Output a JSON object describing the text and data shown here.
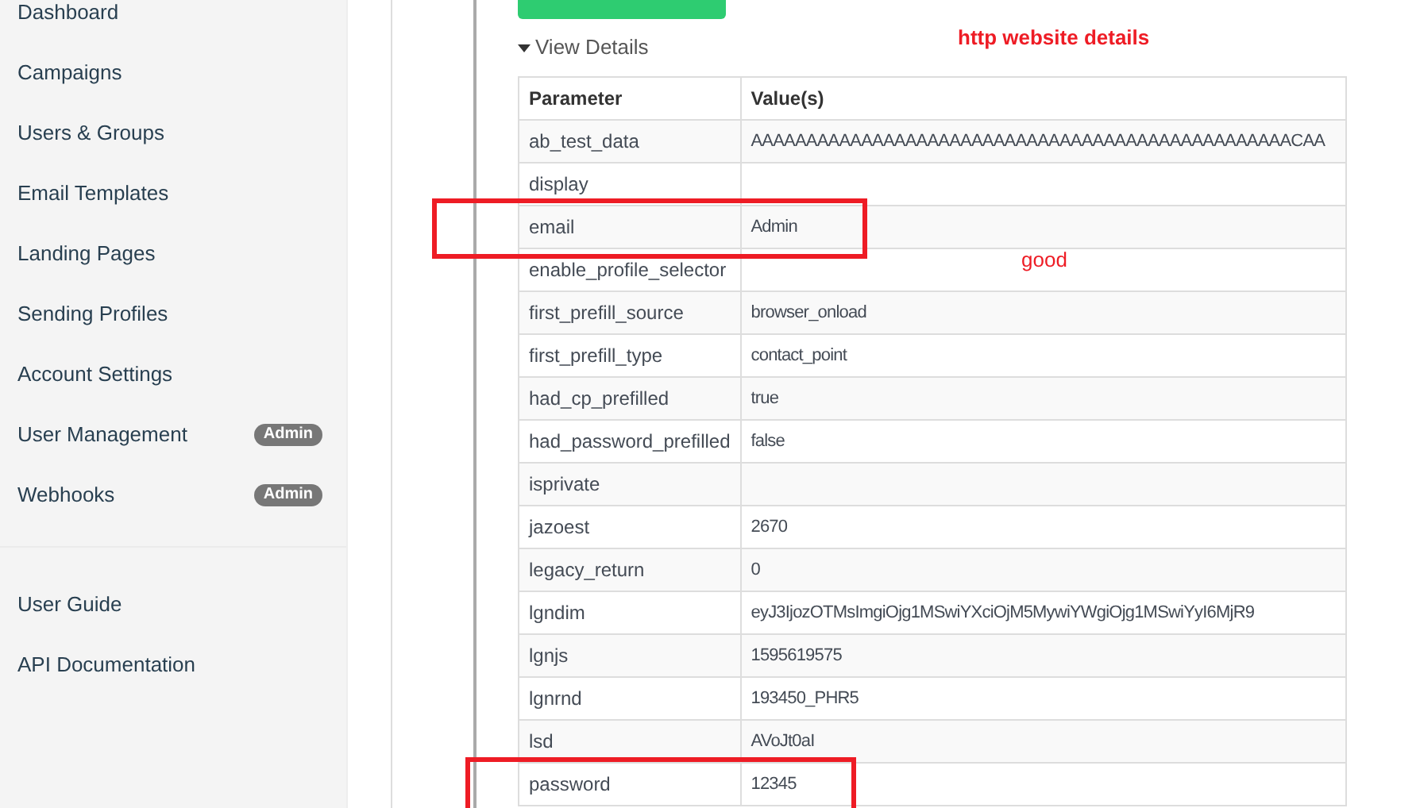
{
  "sidebar": {
    "items": [
      {
        "label": "Dashboard"
      },
      {
        "label": "Campaigns"
      },
      {
        "label": "Users & Groups"
      },
      {
        "label": "Email Templates"
      },
      {
        "label": "Landing Pages"
      },
      {
        "label": "Sending Profiles"
      },
      {
        "label": "Account Settings"
      },
      {
        "label": "User Management",
        "badge": "Admin"
      },
      {
        "label": "Webhooks",
        "badge": "Admin"
      }
    ],
    "footer_items": [
      {
        "label": "User Guide"
      },
      {
        "label": "API Documentation"
      }
    ]
  },
  "details": {
    "label": "View Details",
    "expanded": true
  },
  "table": {
    "columns": [
      "Parameter",
      "Value(s)"
    ],
    "rows": [
      [
        "ab_test_data",
        "AAAAAAAAAAAAAAAAAAAAAAAAAAAAAAAAAAAAAAAAAAAAAAAAACAA"
      ],
      [
        "display",
        ""
      ],
      [
        "email",
        "Admin"
      ],
      [
        "enable_profile_selector",
        ""
      ],
      [
        "first_prefill_source",
        "browser_onload"
      ],
      [
        "first_prefill_type",
        "contact_point"
      ],
      [
        "had_cp_prefilled",
        "true"
      ],
      [
        "had_password_prefilled",
        "false"
      ],
      [
        "isprivate",
        ""
      ],
      [
        "jazoest",
        "2670"
      ],
      [
        "legacy_return",
        "0"
      ],
      [
        "lgndim",
        "eyJ3IjozOTMsImgiOjg1MSwiYXciOjM5MywiYWgiOjg1MSwiYyI6MjR9"
      ],
      [
        "lgnjs",
        "1595619575"
      ],
      [
        "lgnrnd",
        "193450_PHR5"
      ],
      [
        "lsd",
        "AVoJt0aI"
      ],
      [
        "password",
        "12345"
      ]
    ]
  },
  "annotations": [
    {
      "kind": "note",
      "text": "http website details",
      "bold": true
    },
    {
      "kind": "note",
      "text": "good",
      "bold": false
    },
    {
      "kind": "box"
    },
    {
      "kind": "box"
    }
  ]
}
